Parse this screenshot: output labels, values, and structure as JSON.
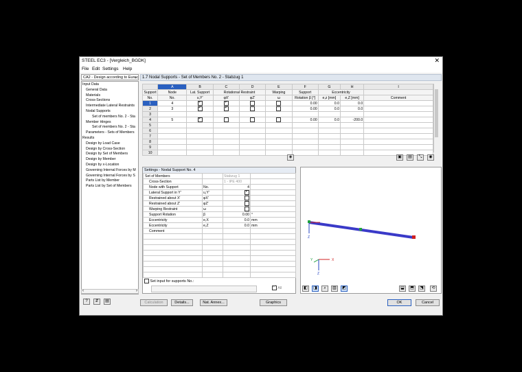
{
  "window": {
    "title": "STEEL EC3 - [Vergleich_BGDK]",
    "close": "✕"
  },
  "menu": [
    "File",
    "Edit",
    "Settings",
    "Help"
  ],
  "case_select": "CA2 - Design according to Euroc",
  "nav": {
    "items": [
      {
        "label": "Input Data",
        "indent": 0
      },
      {
        "label": "General Data",
        "indent": 1
      },
      {
        "label": "Materials",
        "indent": 1
      },
      {
        "label": "Cross-Sections",
        "indent": 1
      },
      {
        "label": "Intermediate Lateral Restraints",
        "indent": 1
      },
      {
        "label": "Nodal Supports",
        "indent": 1
      },
      {
        "label": "Set of members No. 2 - Sta",
        "indent": 2
      },
      {
        "label": "Member Hinges",
        "indent": 1
      },
      {
        "label": "Set of members No. 2 - Sta",
        "indent": 2
      },
      {
        "label": "Parameters - Sets of Members",
        "indent": 1
      },
      {
        "label": "Results",
        "indent": 0
      },
      {
        "label": "Design by Load Case",
        "indent": 1
      },
      {
        "label": "Design by Cross-Section",
        "indent": 1
      },
      {
        "label": "Design by Set of Members",
        "indent": 1
      },
      {
        "label": "Design by Member",
        "indent": 1
      },
      {
        "label": "Design by x-Location",
        "indent": 1
      },
      {
        "label": "Governing Internal Forces by M",
        "indent": 1
      },
      {
        "label": "Governing Internal Forces by S",
        "indent": 1
      },
      {
        "label": "Parts List by Member",
        "indent": 1
      },
      {
        "label": "Parts List by Set of Members",
        "indent": 1
      }
    ]
  },
  "table": {
    "title": "1.7 Nodal Supports - Set of Members No. 2 - Stabzug 1",
    "col_letters": [
      "A",
      "B",
      "C",
      "D",
      "E",
      "F",
      "G",
      "H",
      "I"
    ],
    "group_headers": {
      "support": "Support",
      "node": "Node",
      "lat": "Lat. Support",
      "rot": "Rotational Restraint",
      "warp": "Warping",
      "supp_rot": "Support",
      "ecc": "Eccentricity"
    },
    "sub_headers": {
      "no": "No.",
      "node_no": "No.",
      "uy": "u,Y'",
      "fx": "φX'",
      "fz": "φZ'",
      "w": "ω",
      "rot": "Rotation β [°]",
      "ez": "e,z [mm]",
      "ey": "e,Z [mm]",
      "comment": "Comment"
    },
    "rows": [
      {
        "no": "1",
        "node": "4",
        "lat": true,
        "fx": true,
        "fz": false,
        "w": false,
        "rot": "0.00",
        "e1": "0.0",
        "e2": "0.0"
      },
      {
        "no": "2",
        "node": "3",
        "lat": true,
        "fx": true,
        "fz": false,
        "w": false,
        "rot": "0.00",
        "e1": "0.0",
        "e2": "0.0"
      },
      {
        "no": "3",
        "node": "",
        "lat": null,
        "fx": null,
        "fz": null,
        "w": null,
        "rot": "",
        "e1": "",
        "e2": ""
      },
      {
        "no": "4",
        "node": "5",
        "lat": true,
        "fx": false,
        "fz": false,
        "w": false,
        "rot": "0.00",
        "e1": "0.0",
        "e2": "-200.0"
      },
      {
        "no": "5"
      },
      {
        "no": "6"
      },
      {
        "no": "7"
      },
      {
        "no": "8"
      },
      {
        "no": "9"
      },
      {
        "no": "10"
      }
    ]
  },
  "settings": {
    "title": "Settings - Nodal Support No. 4",
    "rows": [
      {
        "label": "Set of Members",
        "sym": "",
        "value": "Stabzug 1",
        "unit": "",
        "type": "text"
      },
      {
        "label": "Cross-Section",
        "sym": "",
        "value": "1 - IPE 400",
        "unit": "",
        "type": "text"
      },
      {
        "label": "Node with Support",
        "sym": "No.",
        "value": "4",
        "unit": "",
        "type": "val"
      },
      {
        "label": "Lateral Support in Y'",
        "sym": "u,Y'",
        "value": "on",
        "unit": "",
        "type": "cb"
      },
      {
        "label": "Restrained about X'",
        "sym": "φX'",
        "value": "off",
        "unit": "",
        "type": "cb"
      },
      {
        "label": "Restrained about Z'",
        "sym": "φZ'",
        "value": "off",
        "unit": "",
        "type": "cb"
      },
      {
        "label": "Warping Restraint",
        "sym": "ω",
        "value": "off",
        "unit": "",
        "type": "cb"
      },
      {
        "label": "Support Rotation",
        "sym": "β",
        "value": "0.00",
        "unit": "°",
        "type": "val"
      },
      {
        "label": "Eccentricity",
        "sym": "e,X",
        "value": "0.0",
        "unit": "mm",
        "type": "val"
      },
      {
        "label": "Eccentricity",
        "sym": "e,Z",
        "value": "0.0",
        "unit": "mm",
        "type": "val"
      },
      {
        "label": "Comment",
        "sym": "",
        "value": "",
        "unit": "",
        "type": "val"
      }
    ],
    "set_input_label": "Set input for supports No.:",
    "all_label": "All"
  },
  "graphic": {
    "axis_x": "X",
    "axis_y": "Y",
    "axis_z": "Z",
    "beam_color": "#3a3ac8",
    "end_color": "#d02020",
    "mid_color": "#20a040"
  },
  "footer": {
    "calculation": "Calculation",
    "details": "Details...",
    "annex": "Nat. Annex...",
    "graphics": "Graphics",
    "ok": "OK",
    "cancel": "Cancel"
  }
}
